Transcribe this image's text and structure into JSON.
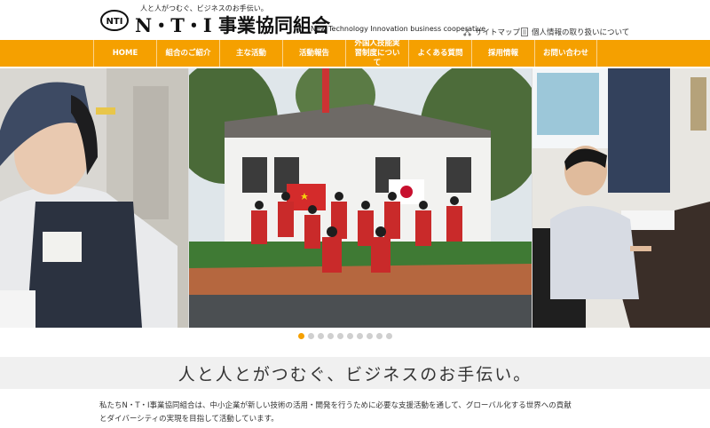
{
  "header": {
    "tagline": "人と人がつむぐ、ビジネスのお手伝い。",
    "org_name": "N・T・I 事業協同組合",
    "badge_text": "NTI",
    "subtitle": "New Technology Innovation business cooperative",
    "sitemap_label": "サイトマップ",
    "privacy_label": "個人情報の取り扱いについて"
  },
  "nav": {
    "items": [
      {
        "label": "HOME"
      },
      {
        "label": "組合のご紹介"
      },
      {
        "label": "主な活動"
      },
      {
        "label": "活動報告"
      },
      {
        "label": "外国人技能実習制度について"
      },
      {
        "label": "よくある質問"
      },
      {
        "label": "採用情報"
      },
      {
        "label": "お問い合わせ"
      }
    ]
  },
  "slider": {
    "dot_count": 10,
    "active_index": 0
  },
  "catchphrase": "人と人とがつむぐ、ビジネスのお手伝い。",
  "intro": {
    "line1": "私たちN・T・I事業協同組合は、中小企業が新しい技術の活用・開発を行うために必要な支援活動を通して、グローバル化する世界への貢献",
    "line2": "とダイバーシティの実現を目指して活動しています。"
  },
  "colors": {
    "accent": "#f5a000",
    "band": "#f0f0f0"
  }
}
